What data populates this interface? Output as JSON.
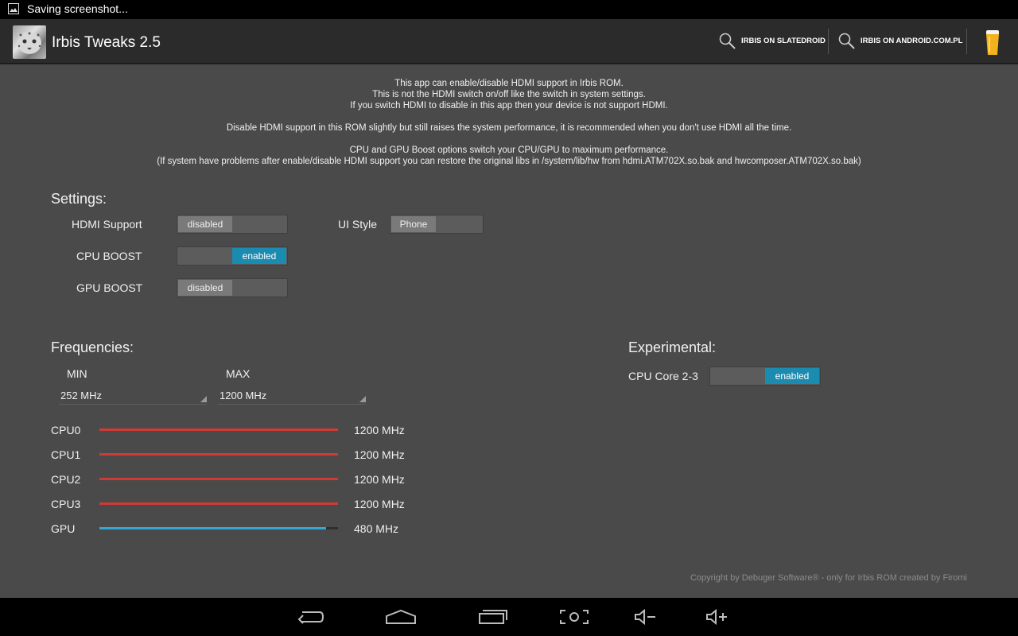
{
  "status_bar": {
    "text": "Saving screenshot...",
    "icon": "image-icon"
  },
  "action_bar": {
    "title": "Irbis Tweaks 2.5",
    "actions": [
      {
        "label": "IRBIS ON SLATEDROID",
        "icon": "search-icon"
      },
      {
        "label": "IRBIS ON ANDROID.COM.PL",
        "icon": "search-icon"
      }
    ],
    "beer_icon": "beer-icon"
  },
  "info": {
    "line1": "This app can enable/disable HDMI support in Irbis ROM.",
    "line2": "This is not the HDMI switch on/off like the switch in system settings.",
    "line3": "If you switch HDMI to disable in this app then your device is not support HDMI.",
    "line4": "Disable HDMI support in this ROM slightly but still raises the system performance, it is recommended when you don't use HDMI all the time.",
    "line5": "CPU and GPU Boost options switch your CPU/GPU to maximum performance.",
    "line6": "(If system have problems after enable/disable HDMI support you can restore the original libs in /system/lib/hw from hdmi.ATM702X.so.bak and hwcomposer.ATM702X.so.bak)"
  },
  "settings": {
    "title": "Settings:",
    "hdmi": {
      "label": "HDMI Support",
      "value": "disabled"
    },
    "cpu_boost": {
      "label": "CPU BOOST",
      "value": "enabled"
    },
    "gpu_boost": {
      "label": "GPU BOOST",
      "value": "disabled"
    },
    "ui_style": {
      "label": "UI Style",
      "value": "Phone"
    }
  },
  "frequencies": {
    "title": "Frequencies:",
    "min_label": "MIN",
    "max_label": "MAX",
    "min_value": "252 MHz",
    "max_value": "1200 MHz",
    "bars": [
      {
        "label": "CPU0",
        "value": "1200 MHz",
        "fraction": 1.0,
        "color": "#d03a36"
      },
      {
        "label": "CPU1",
        "value": "1200 MHz",
        "fraction": 1.0,
        "color": "#d03a36"
      },
      {
        "label": "CPU2",
        "value": "1200 MHz",
        "fraction": 1.0,
        "color": "#d03a36"
      },
      {
        "label": "CPU3",
        "value": "1200 MHz",
        "fraction": 1.0,
        "color": "#d03a36"
      },
      {
        "label": "GPU",
        "value": "480 MHz",
        "fraction": 0.95,
        "color": "#33a7d6"
      }
    ]
  },
  "experimental": {
    "title": "Experimental:",
    "cpu_core": {
      "label": "CPU Core 2-3",
      "value": "enabled"
    }
  },
  "copyright": "Copyright by Debuger Software® - only for Irbis ROM created by Firomi",
  "nav_bar": {
    "buttons": [
      "back-icon",
      "home-icon",
      "recent-apps-icon",
      "screenshot-icon",
      "volume-down-icon",
      "volume-up-icon"
    ]
  },
  "colors": {
    "accent": "#1b8bb0",
    "cpu_bar": "#d03a36",
    "gpu_bar": "#33a7d6",
    "background": "#4a4a4a"
  }
}
